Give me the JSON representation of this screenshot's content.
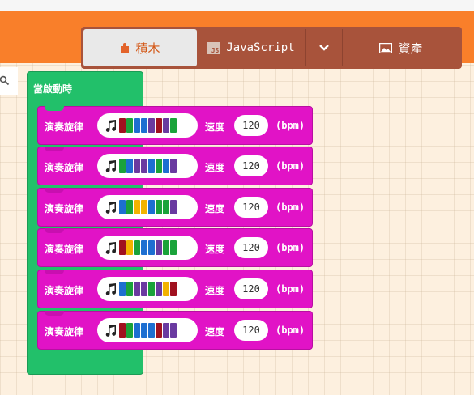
{
  "toolbar": {
    "blocks_label": "積木",
    "javascript_label": "JavaScript",
    "assets_label": "資產"
  },
  "workspace": {
    "event_block_label": "當啟動時",
    "melody_blocks": [
      {
        "label": "演奏旋律",
        "speed_label": "速度",
        "tempo": "120",
        "unit": "(bpm)",
        "notes": [
          "#a0111f",
          "#1aa33a",
          "#1d6fd1",
          "#1d6fd1",
          "#6a3aa0",
          "#a0111f",
          "#6a3aa0",
          "#1aa33a"
        ]
      },
      {
        "label": "演奏旋律",
        "speed_label": "速度",
        "tempo": "120",
        "unit": "(bpm)",
        "notes": [
          "#1aa33a",
          "#1d6fd1",
          "#6a3aa0",
          "#6a3aa0",
          "#1d6fd1",
          "#1aa33a",
          "#1d6fd1",
          "#6a3aa0"
        ]
      },
      {
        "label": "演奏旋律",
        "speed_label": "速度",
        "tempo": "120",
        "unit": "(bpm)",
        "notes": [
          "#1d6fd1",
          "#1aa33a",
          "#f2b300",
          "#f2b300",
          "#1d6fd1",
          "#1aa33a",
          "#1aa33a",
          "#6a3aa0"
        ]
      },
      {
        "label": "演奏旋律",
        "speed_label": "速度",
        "tempo": "120",
        "unit": "(bpm)",
        "notes": [
          "#a0111f",
          "#f2b300",
          "#1aa33a",
          "#1d6fd1",
          "#1d6fd1",
          "#6a3aa0",
          "#1aa33a",
          "#1aa33a"
        ]
      },
      {
        "label": "演奏旋律",
        "speed_label": "速度",
        "tempo": "120",
        "unit": "(bpm)",
        "notes": [
          "#1d6fd1",
          "#1aa33a",
          "#6a3aa0",
          "#6a3aa0",
          "#1aa33a",
          "#6a3aa0",
          "#f2b300",
          "#a0111f"
        ]
      },
      {
        "label": "演奏旋律",
        "speed_label": "速度",
        "tempo": "120",
        "unit": "(bpm)",
        "notes": [
          "#a0111f",
          "#1aa33a",
          "#1d6fd1",
          "#1d6fd1",
          "#1d6fd1",
          "#a0111f",
          "#6a3aa0",
          "#6a3aa0"
        ]
      }
    ]
  },
  "colors": {
    "header_orange": "#f97f2a",
    "toggle_brown": "#a8533b",
    "event_green": "#22c06a",
    "music_magenta": "#e113c6"
  },
  "icons": [
    "puzzle-icon",
    "javascript-icon",
    "chevron-down-icon",
    "image-icon",
    "search-icon",
    "music-note-icon"
  ]
}
